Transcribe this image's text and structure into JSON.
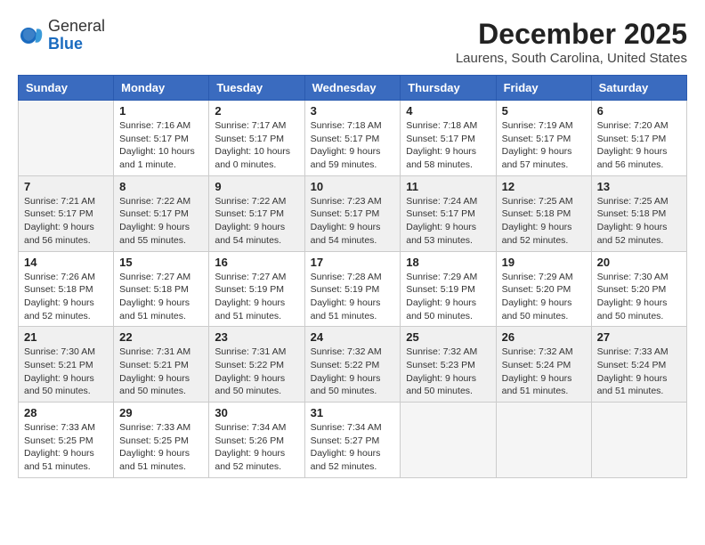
{
  "logo": {
    "general": "General",
    "blue": "Blue"
  },
  "header": {
    "month_year": "December 2025",
    "location": "Laurens, South Carolina, United States"
  },
  "days_of_week": [
    "Sunday",
    "Monday",
    "Tuesday",
    "Wednesday",
    "Thursday",
    "Friday",
    "Saturday"
  ],
  "weeks": [
    [
      {
        "day": "",
        "empty": true
      },
      {
        "day": "1",
        "sunrise": "Sunrise: 7:16 AM",
        "sunset": "Sunset: 5:17 PM",
        "daylight": "Daylight: 10 hours and 1 minute."
      },
      {
        "day": "2",
        "sunrise": "Sunrise: 7:17 AM",
        "sunset": "Sunset: 5:17 PM",
        "daylight": "Daylight: 10 hours and 0 minutes."
      },
      {
        "day": "3",
        "sunrise": "Sunrise: 7:18 AM",
        "sunset": "Sunset: 5:17 PM",
        "daylight": "Daylight: 9 hours and 59 minutes."
      },
      {
        "day": "4",
        "sunrise": "Sunrise: 7:18 AM",
        "sunset": "Sunset: 5:17 PM",
        "daylight": "Daylight: 9 hours and 58 minutes."
      },
      {
        "day": "5",
        "sunrise": "Sunrise: 7:19 AM",
        "sunset": "Sunset: 5:17 PM",
        "daylight": "Daylight: 9 hours and 57 minutes."
      },
      {
        "day": "6",
        "sunrise": "Sunrise: 7:20 AM",
        "sunset": "Sunset: 5:17 PM",
        "daylight": "Daylight: 9 hours and 56 minutes."
      }
    ],
    [
      {
        "day": "7",
        "sunrise": "Sunrise: 7:21 AM",
        "sunset": "Sunset: 5:17 PM",
        "daylight": "Daylight: 9 hours and 56 minutes."
      },
      {
        "day": "8",
        "sunrise": "Sunrise: 7:22 AM",
        "sunset": "Sunset: 5:17 PM",
        "daylight": "Daylight: 9 hours and 55 minutes."
      },
      {
        "day": "9",
        "sunrise": "Sunrise: 7:22 AM",
        "sunset": "Sunset: 5:17 PM",
        "daylight": "Daylight: 9 hours and 54 minutes."
      },
      {
        "day": "10",
        "sunrise": "Sunrise: 7:23 AM",
        "sunset": "Sunset: 5:17 PM",
        "daylight": "Daylight: 9 hours and 54 minutes."
      },
      {
        "day": "11",
        "sunrise": "Sunrise: 7:24 AM",
        "sunset": "Sunset: 5:17 PM",
        "daylight": "Daylight: 9 hours and 53 minutes."
      },
      {
        "day": "12",
        "sunrise": "Sunrise: 7:25 AM",
        "sunset": "Sunset: 5:18 PM",
        "daylight": "Daylight: 9 hours and 52 minutes."
      },
      {
        "day": "13",
        "sunrise": "Sunrise: 7:25 AM",
        "sunset": "Sunset: 5:18 PM",
        "daylight": "Daylight: 9 hours and 52 minutes."
      }
    ],
    [
      {
        "day": "14",
        "sunrise": "Sunrise: 7:26 AM",
        "sunset": "Sunset: 5:18 PM",
        "daylight": "Daylight: 9 hours and 52 minutes."
      },
      {
        "day": "15",
        "sunrise": "Sunrise: 7:27 AM",
        "sunset": "Sunset: 5:18 PM",
        "daylight": "Daylight: 9 hours and 51 minutes."
      },
      {
        "day": "16",
        "sunrise": "Sunrise: 7:27 AM",
        "sunset": "Sunset: 5:19 PM",
        "daylight": "Daylight: 9 hours and 51 minutes."
      },
      {
        "day": "17",
        "sunrise": "Sunrise: 7:28 AM",
        "sunset": "Sunset: 5:19 PM",
        "daylight": "Daylight: 9 hours and 51 minutes."
      },
      {
        "day": "18",
        "sunrise": "Sunrise: 7:29 AM",
        "sunset": "Sunset: 5:19 PM",
        "daylight": "Daylight: 9 hours and 50 minutes."
      },
      {
        "day": "19",
        "sunrise": "Sunrise: 7:29 AM",
        "sunset": "Sunset: 5:20 PM",
        "daylight": "Daylight: 9 hours and 50 minutes."
      },
      {
        "day": "20",
        "sunrise": "Sunrise: 7:30 AM",
        "sunset": "Sunset: 5:20 PM",
        "daylight": "Daylight: 9 hours and 50 minutes."
      }
    ],
    [
      {
        "day": "21",
        "sunrise": "Sunrise: 7:30 AM",
        "sunset": "Sunset: 5:21 PM",
        "daylight": "Daylight: 9 hours and 50 minutes."
      },
      {
        "day": "22",
        "sunrise": "Sunrise: 7:31 AM",
        "sunset": "Sunset: 5:21 PM",
        "daylight": "Daylight: 9 hours and 50 minutes."
      },
      {
        "day": "23",
        "sunrise": "Sunrise: 7:31 AM",
        "sunset": "Sunset: 5:22 PM",
        "daylight": "Daylight: 9 hours and 50 minutes."
      },
      {
        "day": "24",
        "sunrise": "Sunrise: 7:32 AM",
        "sunset": "Sunset: 5:22 PM",
        "daylight": "Daylight: 9 hours and 50 minutes."
      },
      {
        "day": "25",
        "sunrise": "Sunrise: 7:32 AM",
        "sunset": "Sunset: 5:23 PM",
        "daylight": "Daylight: 9 hours and 50 minutes."
      },
      {
        "day": "26",
        "sunrise": "Sunrise: 7:32 AM",
        "sunset": "Sunset: 5:24 PM",
        "daylight": "Daylight: 9 hours and 51 minutes."
      },
      {
        "day": "27",
        "sunrise": "Sunrise: 7:33 AM",
        "sunset": "Sunset: 5:24 PM",
        "daylight": "Daylight: 9 hours and 51 minutes."
      }
    ],
    [
      {
        "day": "28",
        "sunrise": "Sunrise: 7:33 AM",
        "sunset": "Sunset: 5:25 PM",
        "daylight": "Daylight: 9 hours and 51 minutes."
      },
      {
        "day": "29",
        "sunrise": "Sunrise: 7:33 AM",
        "sunset": "Sunset: 5:25 PM",
        "daylight": "Daylight: 9 hours and 51 minutes."
      },
      {
        "day": "30",
        "sunrise": "Sunrise: 7:34 AM",
        "sunset": "Sunset: 5:26 PM",
        "daylight": "Daylight: 9 hours and 52 minutes."
      },
      {
        "day": "31",
        "sunrise": "Sunrise: 7:34 AM",
        "sunset": "Sunset: 5:27 PM",
        "daylight": "Daylight: 9 hours and 52 minutes."
      },
      {
        "day": "",
        "empty": true
      },
      {
        "day": "",
        "empty": true
      },
      {
        "day": "",
        "empty": true
      }
    ]
  ]
}
